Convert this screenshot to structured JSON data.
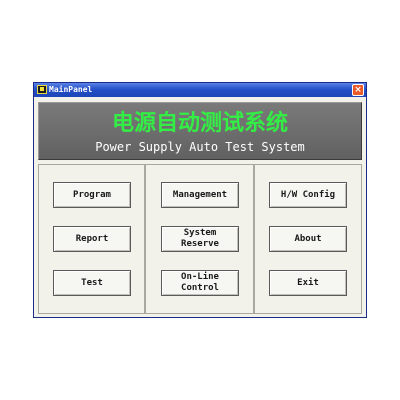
{
  "window": {
    "title": "MainPanel",
    "close_label": "×"
  },
  "header": {
    "title_cn": "电源自动测试系统",
    "title_en": "Power Supply Auto Test System"
  },
  "buttons": {
    "program": "Program",
    "report": "Report",
    "test": "Test",
    "management": "Management",
    "system_reserve": "System\nReserve",
    "online_control": "On-Line\nControl",
    "hw_config": "H/W Config",
    "about": "About",
    "exit": "Exit"
  },
  "colors": {
    "title_cn": "#33ee44",
    "header_bg": "#6e6e6e",
    "titlebar": "#2450c8"
  },
  "icons": {
    "app": "app-icon",
    "close": "close-icon"
  }
}
